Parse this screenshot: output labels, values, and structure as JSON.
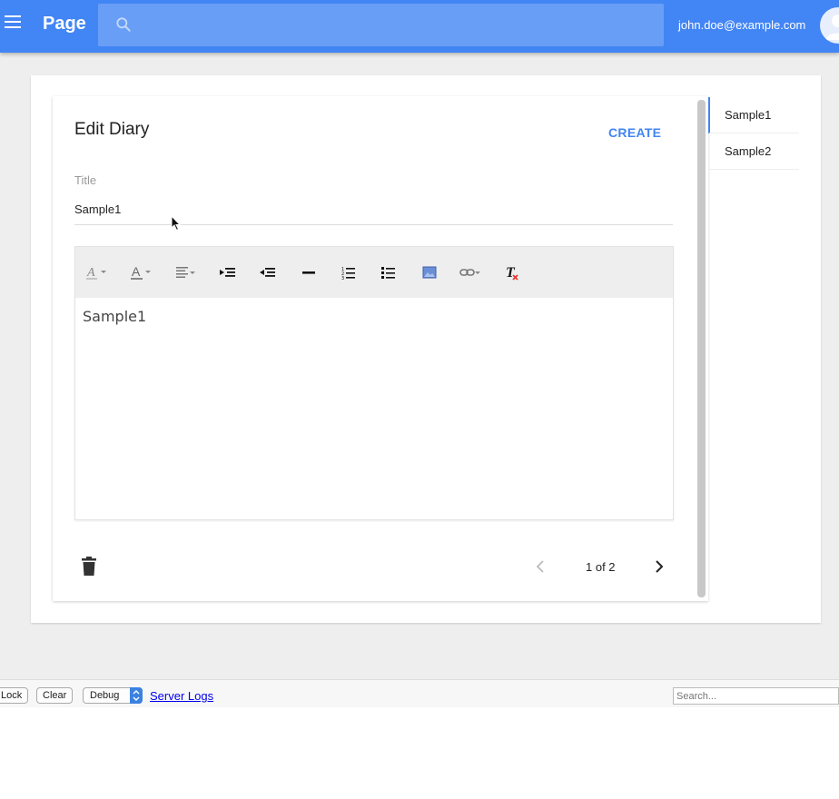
{
  "appbar": {
    "title": "Page",
    "search_placeholder": "",
    "user_email": "john.doe@example.com",
    "color": "#4285f4"
  },
  "editor": {
    "heading": "Edit Diary",
    "create_label": "CREATE",
    "title_label": "Title",
    "title_value": "Sample1",
    "content": "Sample1",
    "toolbar_icons": [
      "font-style-icon",
      "font-color-icon",
      "align-icon",
      "indent-icon",
      "outdent-icon",
      "horizontal-rule-icon",
      "ordered-list-icon",
      "unordered-list-icon",
      "image-icon",
      "link-icon",
      "clear-format-icon"
    ],
    "pager_text": "1 of 2"
  },
  "side_list": {
    "items": [
      {
        "label": "Sample1",
        "active": true
      },
      {
        "label": "Sample2",
        "active": false
      }
    ]
  },
  "debug_bar": {
    "lock_label": "Lock",
    "clear_label": "Clear",
    "debug_label": "Debug",
    "server_logs_label": "Server Logs",
    "search_placeholder": "Search..."
  }
}
